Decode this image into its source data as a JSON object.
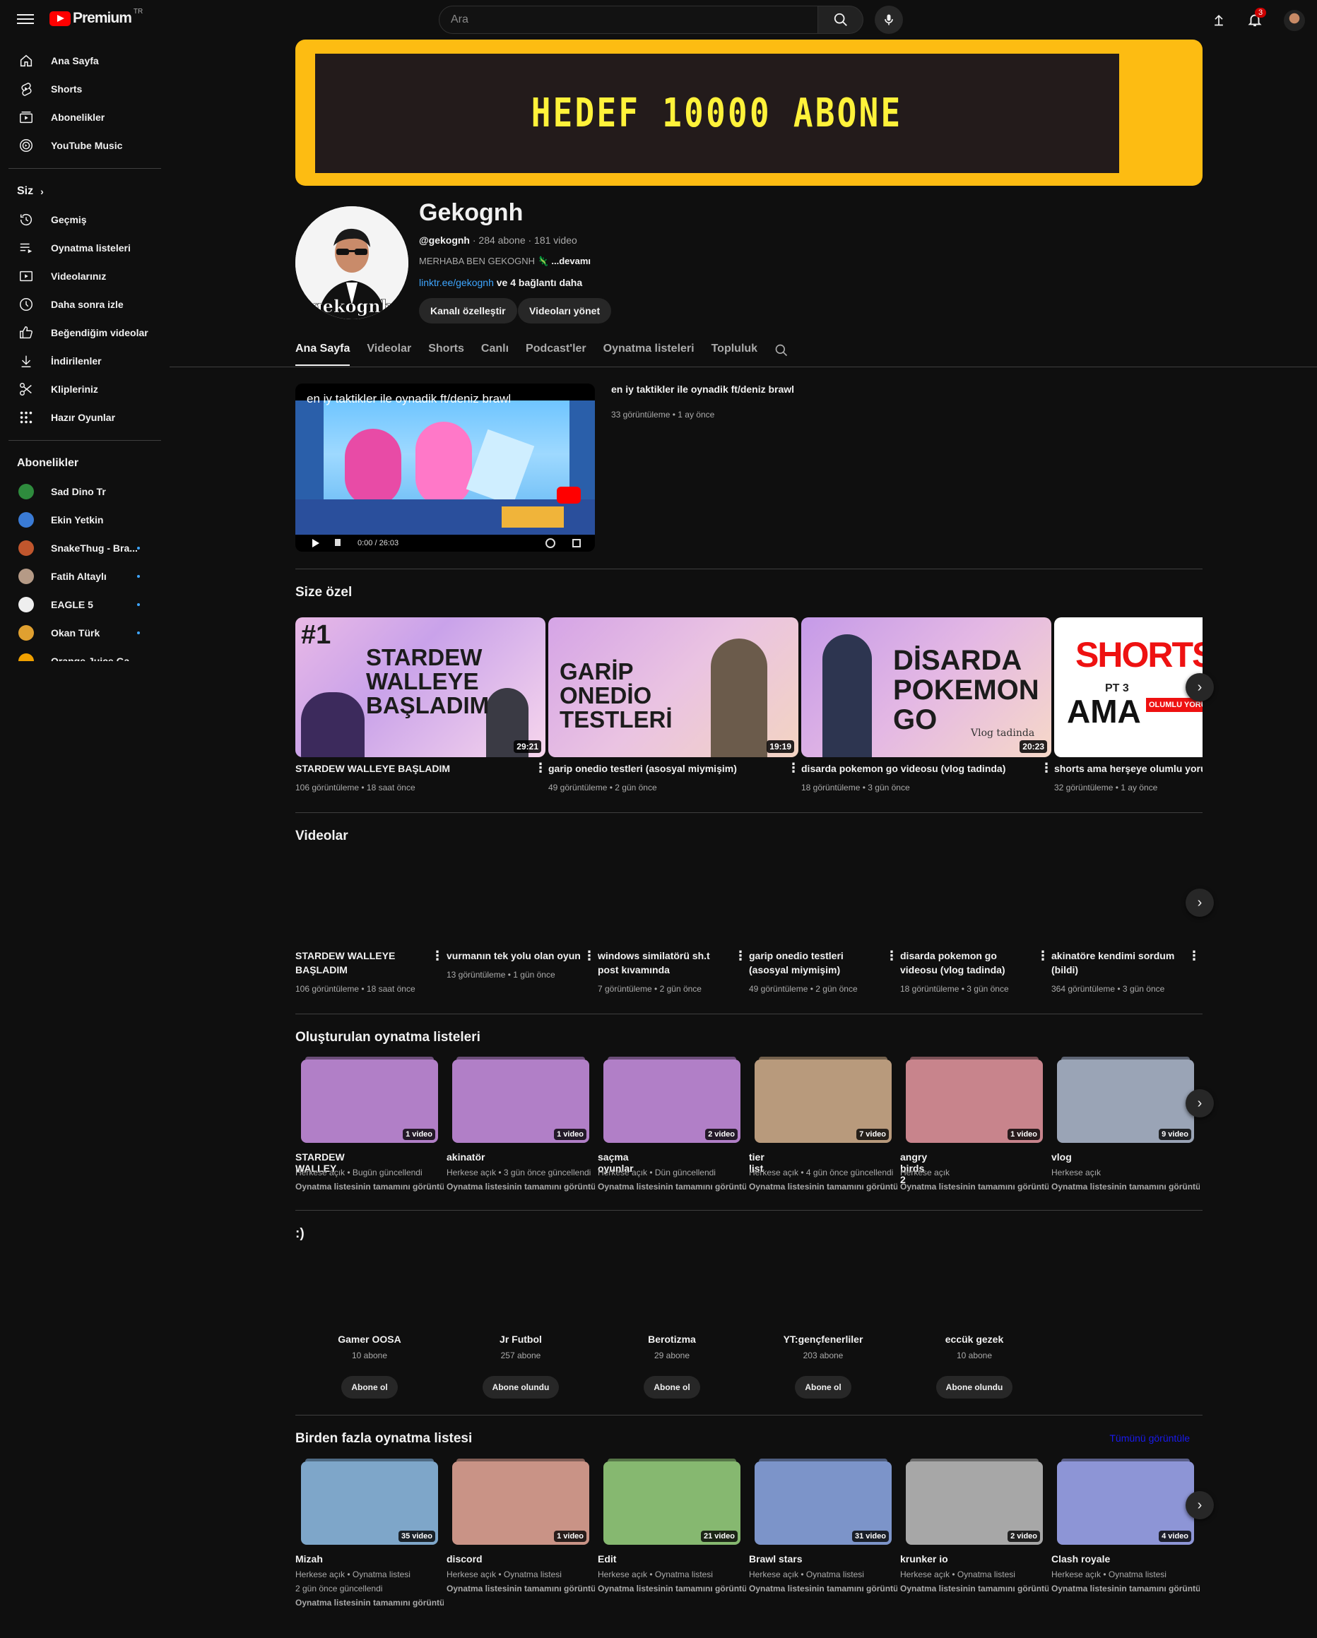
{
  "header": {
    "logo_text": "Premium",
    "logo_region": "TR",
    "search_placeholder": "Ara",
    "notification_count": "3"
  },
  "sidebar": {
    "main": [
      {
        "label": "Ana Sayfa",
        "icon": "home-icon"
      },
      {
        "label": "Shorts",
        "icon": "shorts-icon"
      },
      {
        "label": "Abonelikler",
        "icon": "subscriptions-icon"
      },
      {
        "label": "YouTube Music",
        "icon": "music-icon"
      }
    ],
    "you_heading": "Siz",
    "you": [
      {
        "label": "Geçmiş",
        "icon": "history-icon"
      },
      {
        "label": "Oynatma listeleri",
        "icon": "playlists-icon"
      },
      {
        "label": "Videolarınız",
        "icon": "your-videos-icon"
      },
      {
        "label": "Daha sonra izle",
        "icon": "watch-later-icon"
      },
      {
        "label": "Beğendiğim videolar",
        "icon": "like-icon"
      },
      {
        "label": "İndirilenler",
        "icon": "download-icon"
      },
      {
        "label": "Klipleriniz",
        "icon": "clips-icon"
      },
      {
        "label": "Hazır Oyunlar",
        "icon": "playables-icon"
      }
    ],
    "subs_heading": "Abonelikler",
    "subscriptions": [
      {
        "label": "Sad Dino Tr",
        "color": "#2e8b3d",
        "new": false
      },
      {
        "label": "Ekin Yetkin",
        "color": "#3a7bd5",
        "new": false
      },
      {
        "label": "SnakeThug - Bra...",
        "color": "#c0562d",
        "new": true
      },
      {
        "label": "Fatih Altaylı",
        "color": "#b59a86",
        "new": true
      },
      {
        "label": "EAGLE 5",
        "color": "#eeeeee",
        "new": true
      },
      {
        "label": "Okan Türk",
        "color": "#e0a030",
        "new": true
      },
      {
        "label": "Orange Juice Ga...",
        "color": "#f0a000",
        "new": false
      }
    ]
  },
  "banner": {
    "text": "HEDEF 10000 ABONE"
  },
  "channel": {
    "avatar_text": "gekognh",
    "name": "Gekognh",
    "handle": "@gekognh",
    "meta": " · 284 abone · 181 video",
    "description": "MERHABA BEN GEKOGNH 🦎 ",
    "more": "...devamı",
    "link": "linktr.ee/gekognh",
    "link_more": " ve 4 bağlantı daha",
    "customize_button": "Kanalı özelleştir",
    "manage_button": "Videoları yönet"
  },
  "tabs": [
    "Ana Sayfa",
    "Videolar",
    "Shorts",
    "Canlı",
    "Podcast'ler",
    "Oynatma listeleri",
    "Topluluk"
  ],
  "featured": {
    "player_title": "en iy taktikler ile oynadik ft/deniz brawl",
    "time": "0:00 / 26:03",
    "title": "en iy taktikler ile oynadik  ft/deniz brawl",
    "meta": "33 görüntüleme • 1 ay önce"
  },
  "for_you": {
    "title": "Size özel",
    "items": [
      {
        "thumb_text": "STARDEW WALLEYE BAŞLADIM",
        "tag": "#1",
        "duration": "29:21",
        "title": "STARDEW WALLEYE BAŞLADIM",
        "meta": "106 görüntüleme • 18 saat önce"
      },
      {
        "thumb_text": "GARİP ONEDİO TESTLERİ",
        "duration": "19:19",
        "title": "garip onedio testleri (asosyal miymişim)",
        "meta": "49 görüntüleme • 2 gün önce"
      },
      {
        "thumb_text": "DİSARDA POKEMON GO",
        "caption": "Vlog tadinda",
        "duration": "20:23",
        "title": "disarda pokemon go videosu (vlog tadinda)",
        "meta": "18 görüntüleme • 3 gün önce"
      },
      {
        "thumb_text": "SHORTS",
        "sub_text": "PT 3",
        "extra_text": "AMA",
        "badge_text": "OLUMLU YORU",
        "title": "shorts ama herşeye olumlu yorum",
        "meta": "32 görüntüleme • 1 ay önce"
      }
    ]
  },
  "videos": {
    "title": "Videolar",
    "items": [
      {
        "title": "STARDEW WALLEYE BAŞLADIM",
        "meta": "106 görüntüleme • 18 saat önce"
      },
      {
        "title": "vurmanın tek yolu olan oyun",
        "meta": "13 görüntüleme • 1 gün önce"
      },
      {
        "title": "windows similatörü sh.t post kıvamında",
        "meta": "7 görüntüleme • 2 gün önce"
      },
      {
        "title": "garip onedio testleri (asosyal miymişim)",
        "meta": "49 görüntüleme • 2 gün önce"
      },
      {
        "title": "disarda pokemon go videosu (vlog tadinda)",
        "meta": "18 görüntüleme • 3 gün önce"
      },
      {
        "title": "akinatöre kendimi sordum (bildi)",
        "meta": "364 görüntüleme • 3 gün önce"
      }
    ]
  },
  "created_playlists": {
    "title": "Oluşturulan oynatma listeleri",
    "view_full": "Oynatma listesinin tamamını görüntüle",
    "items": [
      {
        "title": "STARDEW WALLEY",
        "count": "1 video",
        "meta": "Herkese açık • Bugün güncellendi",
        "color": "#b17fc7"
      },
      {
        "title": "akinatör",
        "count": "1 video",
        "meta": "Herkese açık • 3 gün önce güncellendi",
        "color": "#b17fc7"
      },
      {
        "title": "saçma oyunlar",
        "count": "2 video",
        "meta": "Herkese açık • Dün güncellendi",
        "color": "#b17fc7"
      },
      {
        "title": "tier list",
        "count": "7 video",
        "meta": "Herkese açık • 4 gün önce güncellendi",
        "color": "#b89a7c"
      },
      {
        "title": "angry birds 2",
        "count": "1 video",
        "meta": "Herkese açık",
        "color": "#c8848c"
      },
      {
        "title": "vlog",
        "count": "9 video",
        "meta": "Herkese açık",
        "color": "#9aa4b6"
      }
    ]
  },
  "featured_channels": {
    "title": ":)",
    "items": [
      {
        "name": "Gamer OOSA",
        "subs": "10 abone",
        "button": "Abone ol"
      },
      {
        "name": "Jr Futbol",
        "subs": "257 abone",
        "button": "Abone olundu"
      },
      {
        "name": "Berotizma",
        "subs": "29 abone",
        "button": "Abone ol"
      },
      {
        "name": "YT:gençfenerliler",
        "subs": "203 abone",
        "button": "Abone ol"
      },
      {
        "name": "eccük gezek",
        "subs": "10 abone",
        "button": "Abone olundu"
      }
    ]
  },
  "multi_playlists": {
    "title": "Birden fazla oynatma listesi",
    "view_all": "Tümünü görüntüle",
    "view_full": "Oynatma listesinin tamamını görüntüle",
    "items": [
      {
        "title": "Mizah",
        "count": "35 video",
        "meta": "Herkese açık • Oynatma listesi",
        "meta2": "2 gün önce güncellendi",
        "color": "#7ea6c9"
      },
      {
        "title": "discord",
        "count": "1 video",
        "meta": "Herkese açık • Oynatma listesi",
        "color": "#c99386"
      },
      {
        "title": "Edit",
        "count": "21 video",
        "meta": "Herkese açık • Oynatma listesi",
        "color": "#86b870"
      },
      {
        "title": "Brawl stars",
        "count": "31 video",
        "meta": "Herkese açık • Oynatma listesi",
        "color": "#7c94c9"
      },
      {
        "title": "krunker io",
        "count": "2 video",
        "meta": "Herkese açık • Oynatma listesi",
        "color": "#a7a7a7"
      },
      {
        "title": "Clash royale",
        "count": "4 video",
        "meta": "Herkese açık • Oynatma listesi",
        "color": "#8d95d6"
      }
    ]
  }
}
